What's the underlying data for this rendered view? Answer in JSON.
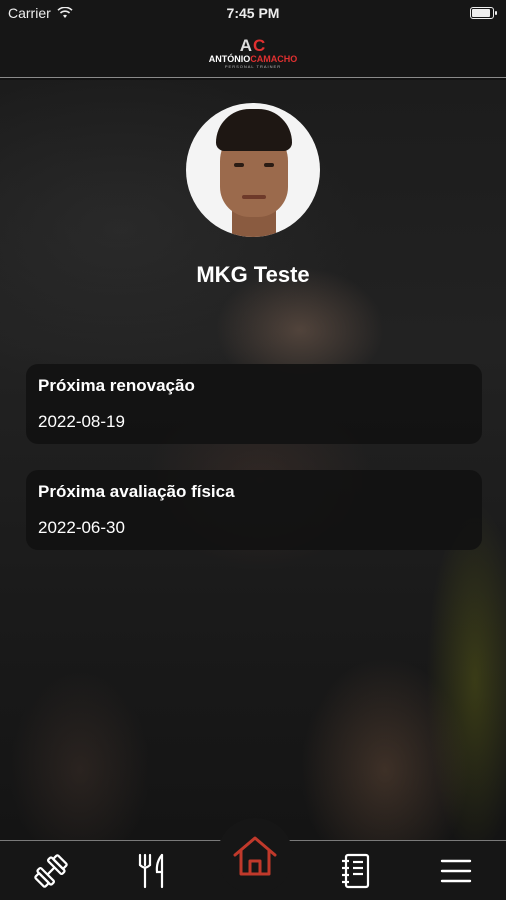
{
  "status_bar": {
    "carrier": "Carrier",
    "time": "7:45 PM",
    "wifi_icon": "wifi-icon",
    "battery_icon": "battery-icon"
  },
  "header": {
    "logo_mark_a": "A",
    "logo_mark_c": "C",
    "logo_first": "ANTÓNIO",
    "logo_last": "CAMACHO",
    "logo_sub": "PERSONAL TRAINER"
  },
  "profile": {
    "name": "MKG Teste"
  },
  "cards": [
    {
      "title": "Próxima renovação",
      "value": "2022-08-19"
    },
    {
      "title": "Próxima avaliação física",
      "value": "2022-06-30"
    }
  ],
  "nav": {
    "items": [
      {
        "icon": "dumbbell-icon"
      },
      {
        "icon": "fork-knife-icon"
      },
      {
        "icon": "home-icon",
        "active": true
      },
      {
        "icon": "notebook-icon"
      },
      {
        "icon": "menu-icon"
      }
    ],
    "accent": "#c0392b",
    "icon_color": "#ffffff"
  },
  "colors": {
    "brand_red": "#e03030",
    "card_bg": "#121212"
  }
}
